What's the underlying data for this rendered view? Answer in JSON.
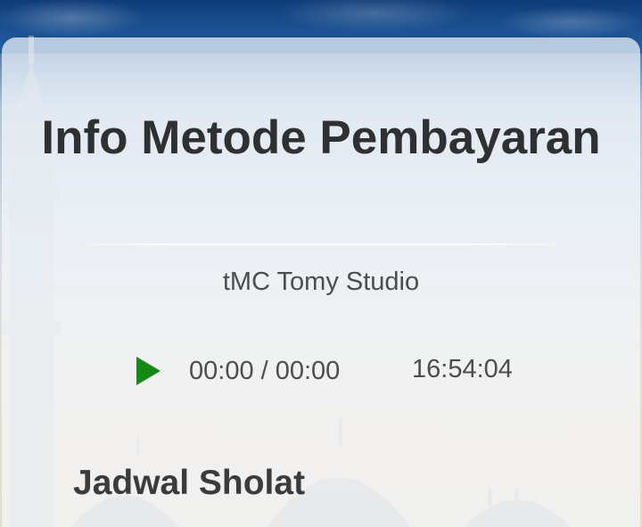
{
  "header": {
    "title": "Info Metode Pembayaran"
  },
  "studio_name": "tMC Tomy Studio",
  "player": {
    "play_icon": "play-icon",
    "time_display": "00:00 / 00:00",
    "accent_color": "#1a8a1a"
  },
  "clock": "16:54:04",
  "section": {
    "title": "Jadwal Sholat"
  }
}
